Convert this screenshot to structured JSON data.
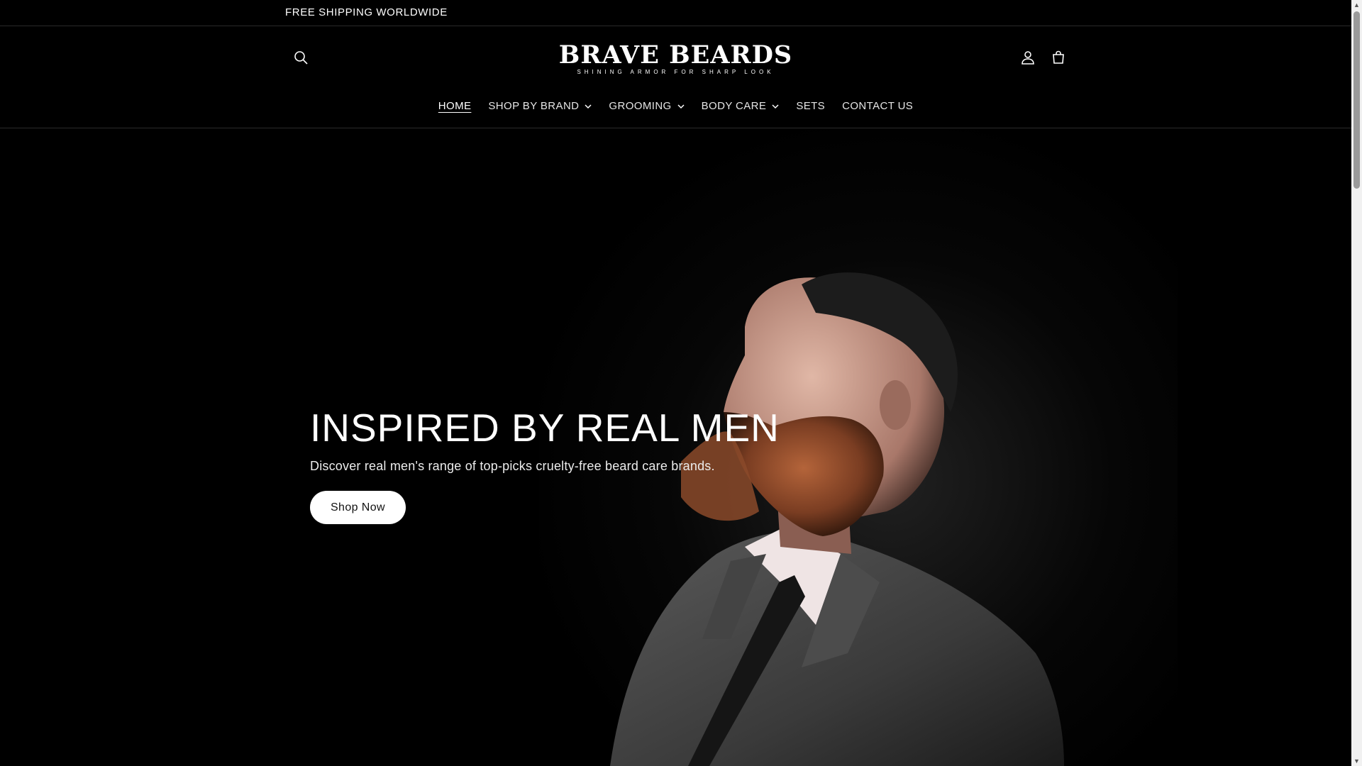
{
  "announcement": {
    "text": "FREE SHIPPING WORLDWIDE"
  },
  "header": {
    "logo_title": "BRAVE BEARDS",
    "logo_tagline": "SHINING ARMOR FOR SHARP LOOK",
    "icons": {
      "search": "search-icon",
      "account": "account-icon",
      "cart": "cart-icon"
    }
  },
  "nav": {
    "items": [
      {
        "label": "HOME",
        "active": true,
        "dropdown": false
      },
      {
        "label": "SHOP BY BRAND",
        "dropdown": true
      },
      {
        "label": "GROOMING",
        "dropdown": true
      },
      {
        "label": "BODY CARE",
        "dropdown": true
      },
      {
        "label": "SETS",
        "dropdown": false
      },
      {
        "label": "CONTACT US",
        "dropdown": false
      }
    ]
  },
  "hero": {
    "title": "INSPIRED BY REAL MEN",
    "subtitle": "Discover real men's range of top-picks cruelty-free beard care brands.",
    "button_label": "Shop Now"
  },
  "colors": {
    "background": "#000000",
    "text": "#ffffff",
    "button_bg": "#ffffff",
    "button_text": "#111111"
  }
}
